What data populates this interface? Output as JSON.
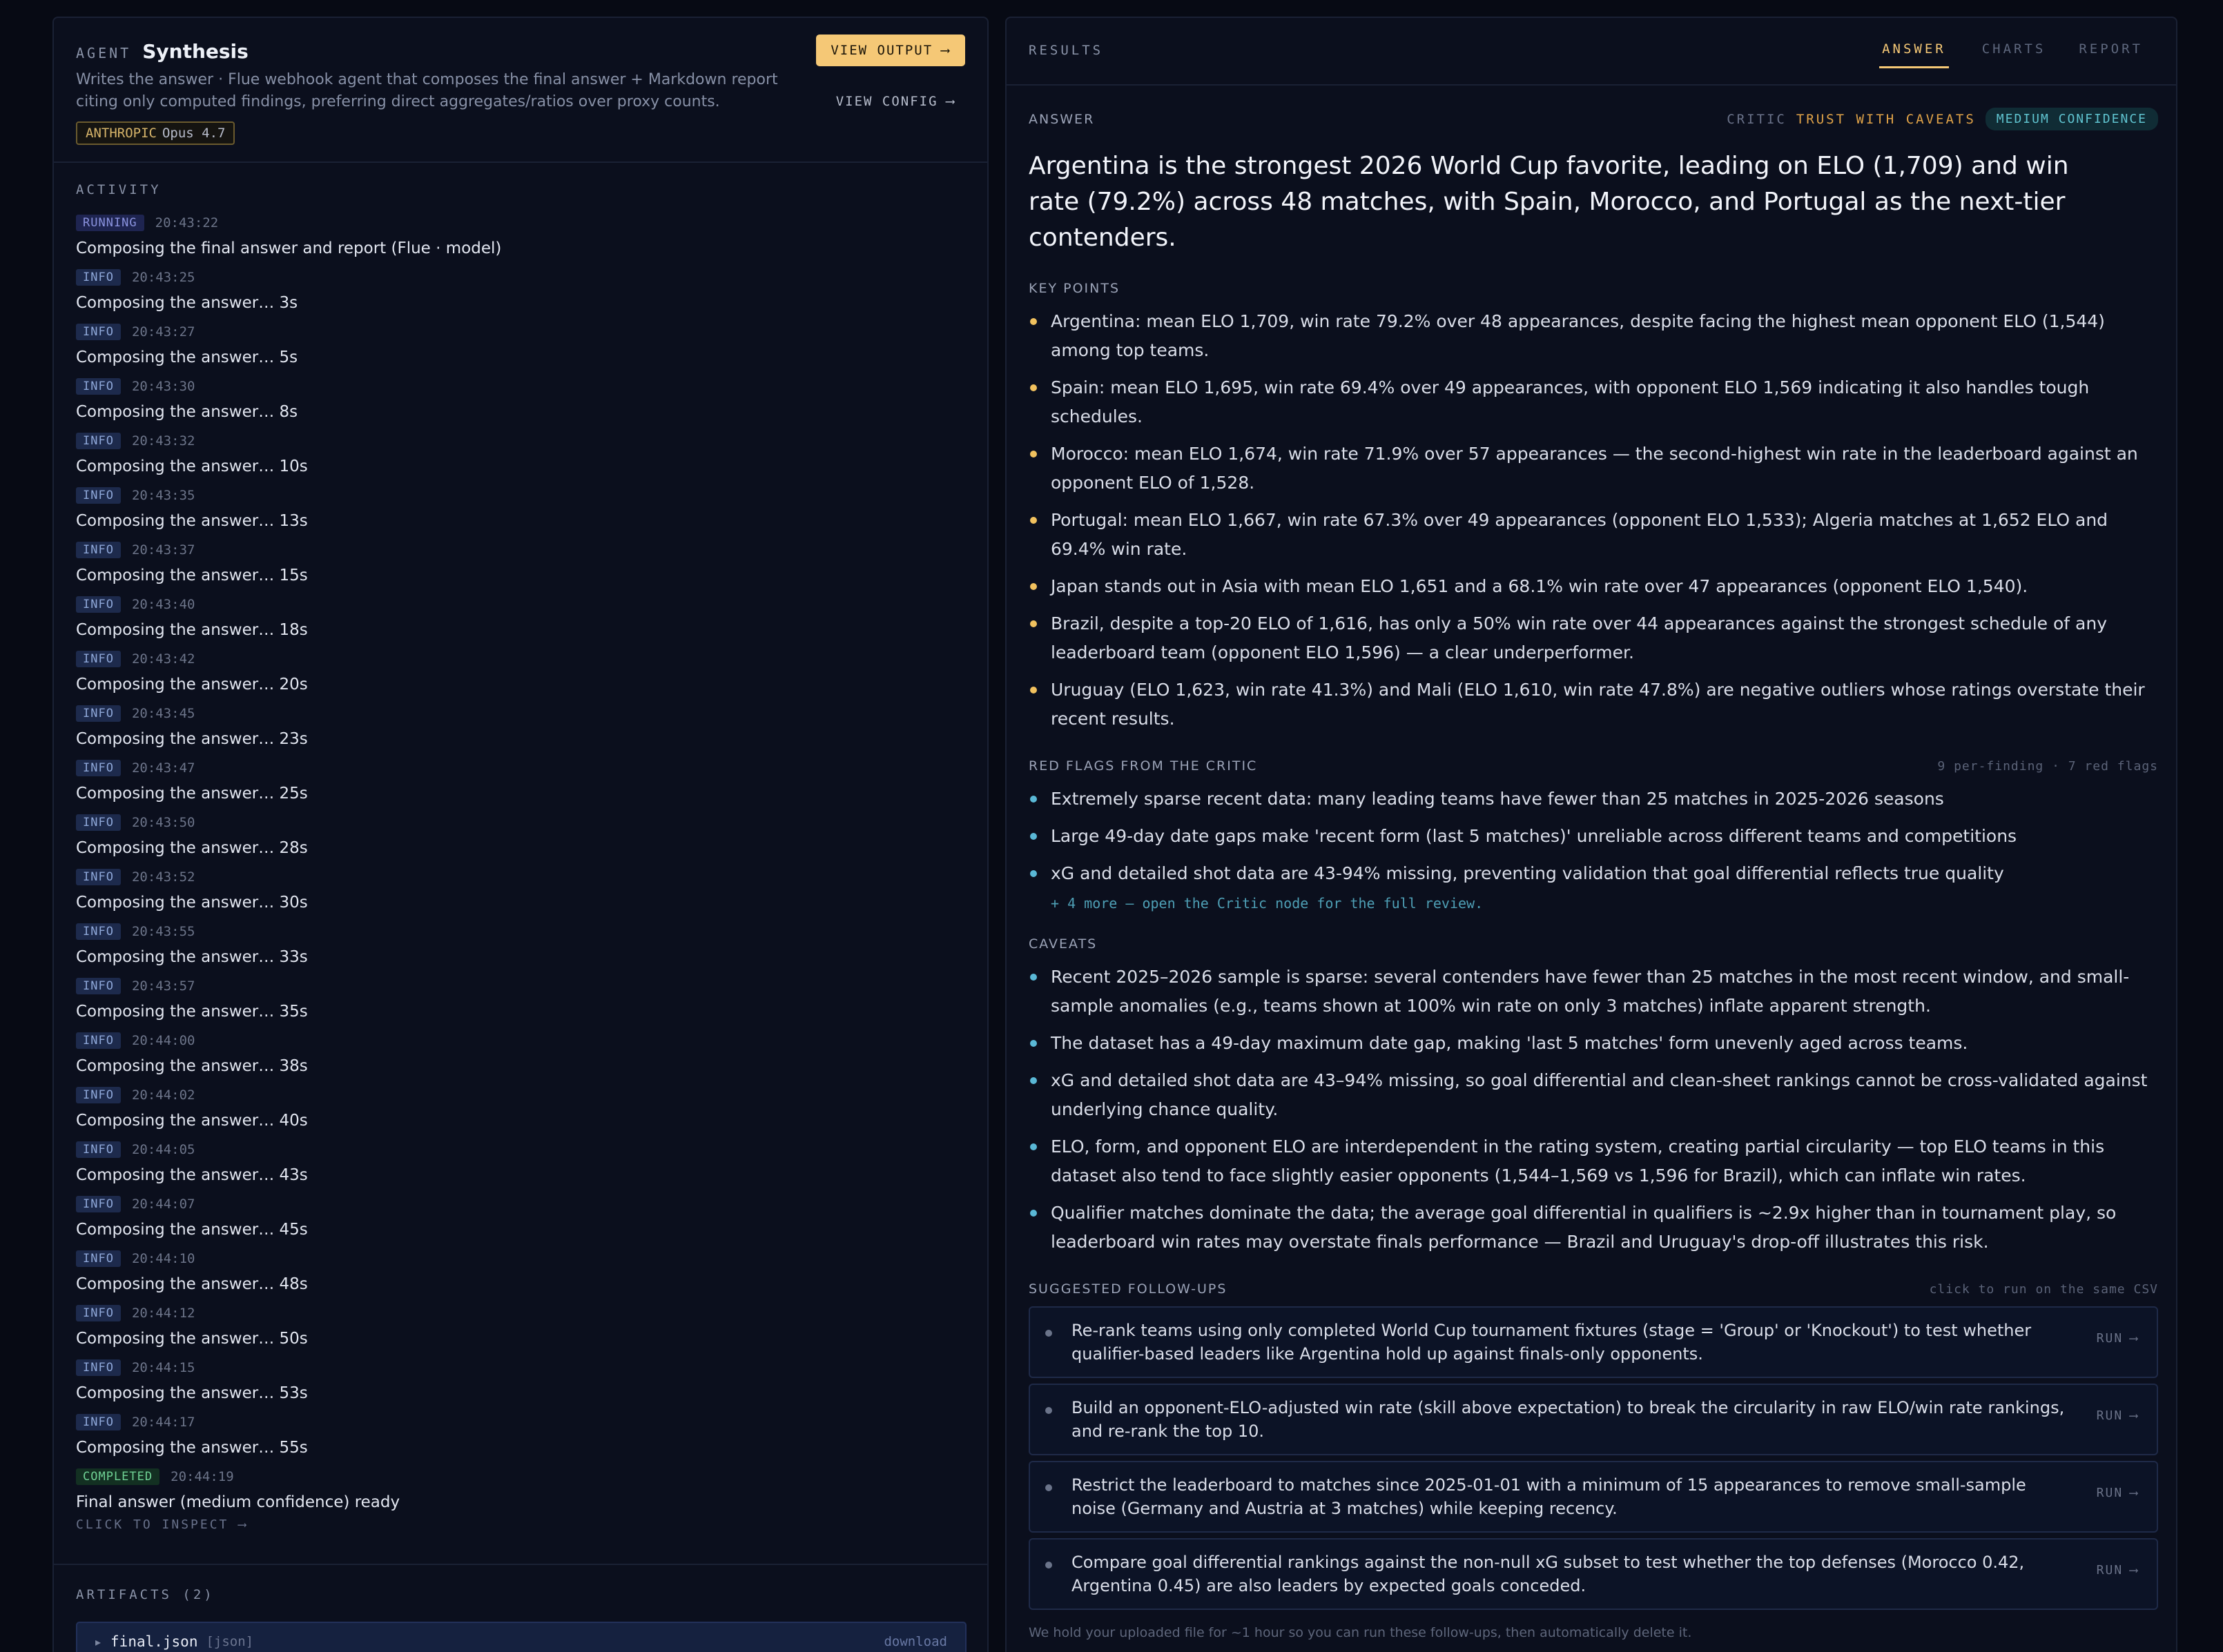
{
  "agent": {
    "label": "AGENT",
    "name": "Synthesis",
    "description": "Writes the answer · Flue webhook agent that composes the final answer + Markdown report citing only computed findings, preferring direct aggregates/ratios over proxy counts.",
    "provider": "ANTHROPIC",
    "model": "Opus 4.7",
    "view_output_label": "VIEW OUTPUT",
    "view_config_label": "VIEW CONFIG"
  },
  "activity": {
    "title": "ACTIVITY",
    "entries": [
      {
        "status": "RUNNING",
        "time": "20:43:22",
        "text": "Composing the final answer and report (Flue · model)"
      },
      {
        "status": "INFO",
        "time": "20:43:25",
        "text": "Composing the answer… 3s"
      },
      {
        "status": "INFO",
        "time": "20:43:27",
        "text": "Composing the answer… 5s"
      },
      {
        "status": "INFO",
        "time": "20:43:30",
        "text": "Composing the answer… 8s"
      },
      {
        "status": "INFO",
        "time": "20:43:32",
        "text": "Composing the answer… 10s"
      },
      {
        "status": "INFO",
        "time": "20:43:35",
        "text": "Composing the answer… 13s"
      },
      {
        "status": "INFO",
        "time": "20:43:37",
        "text": "Composing the answer… 15s"
      },
      {
        "status": "INFO",
        "time": "20:43:40",
        "text": "Composing the answer… 18s"
      },
      {
        "status": "INFO",
        "time": "20:43:42",
        "text": "Composing the answer… 20s"
      },
      {
        "status": "INFO",
        "time": "20:43:45",
        "text": "Composing the answer… 23s"
      },
      {
        "status": "INFO",
        "time": "20:43:47",
        "text": "Composing the answer… 25s"
      },
      {
        "status": "INFO",
        "time": "20:43:50",
        "text": "Composing the answer… 28s"
      },
      {
        "status": "INFO",
        "time": "20:43:52",
        "text": "Composing the answer… 30s"
      },
      {
        "status": "INFO",
        "time": "20:43:55",
        "text": "Composing the answer… 33s"
      },
      {
        "status": "INFO",
        "time": "20:43:57",
        "text": "Composing the answer… 35s"
      },
      {
        "status": "INFO",
        "time": "20:44:00",
        "text": "Composing the answer… 38s"
      },
      {
        "status": "INFO",
        "time": "20:44:02",
        "text": "Composing the answer… 40s"
      },
      {
        "status": "INFO",
        "time": "20:44:05",
        "text": "Composing the answer… 43s"
      },
      {
        "status": "INFO",
        "time": "20:44:07",
        "text": "Composing the answer… 45s"
      },
      {
        "status": "INFO",
        "time": "20:44:10",
        "text": "Composing the answer… 48s"
      },
      {
        "status": "INFO",
        "time": "20:44:12",
        "text": "Composing the answer… 50s"
      },
      {
        "status": "INFO",
        "time": "20:44:15",
        "text": "Composing the answer… 53s"
      },
      {
        "status": "INFO",
        "time": "20:44:17",
        "text": "Composing the answer… 55s"
      },
      {
        "status": "COMPLETED",
        "time": "20:44:19",
        "text": "Final answer (medium confidence) ready"
      }
    ],
    "inspect_label": "CLICK TO INSPECT"
  },
  "artifacts": {
    "title": "ARTIFACTS (2)",
    "items": [
      {
        "name": "final.json",
        "type": "[json]",
        "action": "download"
      }
    ]
  },
  "results": {
    "title": "RESULTS",
    "tabs": [
      {
        "label": "ANSWER",
        "active": true
      },
      {
        "label": "CHARTS",
        "active": false
      },
      {
        "label": "REPORT",
        "active": false
      }
    ],
    "answer_label": "ANSWER",
    "critic_label": "CRITIC",
    "critic_verdict": "TRUST WITH CAVEATS",
    "confidence": "MEDIUM CONFIDENCE",
    "headline": "Argentina is the strongest 2026 World Cup favorite, leading on ELO (1,709) and win rate (79.2%) across 48 matches, with Spain, Morocco, and Portugal as the next-tier contenders.",
    "key_points_label": "KEY POINTS",
    "key_points": [
      "Argentina: mean ELO 1,709, win rate 79.2% over 48 appearances, despite facing the highest mean opponent ELO (1,544) among top teams.",
      "Spain: mean ELO 1,695, win rate 69.4% over 49 appearances, with opponent ELO 1,569 indicating it also handles tough schedules.",
      "Morocco: mean ELO 1,674, win rate 71.9% over 57 appearances — the second-highest win rate in the leaderboard against an opponent ELO of 1,528.",
      "Portugal: mean ELO 1,667, win rate 67.3% over 49 appearances (opponent ELO 1,533); Algeria matches at 1,652 ELO and 69.4% win rate.",
      "Japan stands out in Asia with mean ELO 1,651 and a 68.1% win rate over 47 appearances (opponent ELO 1,540).",
      "Brazil, despite a top-20 ELO of 1,616, has only a 50% win rate over 44 appearances against the strongest schedule of any leaderboard team (opponent ELO 1,596) — a clear underperformer.",
      "Uruguay (ELO 1,623, win rate 41.3%) and Mali (ELO 1,610, win rate 47.8%) are negative outliers whose ratings overstate their recent results."
    ],
    "red_flags_label": "RED FLAGS FROM THE CRITIC",
    "red_flags_note": "9 per-finding · 7 red flags",
    "red_flags": [
      "Extremely sparse recent data: many leading teams have fewer than 25 matches in 2025-2026 seasons",
      "Large 49-day date gaps make 'recent form (last 5 matches)' unreliable across different teams and competitions",
      "xG and detailed shot data are 43-94% missing, preventing validation that goal differential reflects true quality"
    ],
    "red_flags_more": "+ 4 more — open the Critic node for the full review.",
    "caveats_label": "CAVEATS",
    "caveats": [
      "Recent 2025–2026 sample is sparse: several contenders have fewer than 25 matches in the most recent window, and small-sample anomalies (e.g., teams shown at 100% win rate on only 3 matches) inflate apparent strength.",
      "The dataset has a 49-day maximum date gap, making 'last 5 matches' form unevenly aged across teams.",
      "xG and detailed shot data are 43–94% missing, so goal differential and clean-sheet rankings cannot be cross-validated against underlying chance quality.",
      "ELO, form, and opponent ELO are interdependent in the rating system, creating partial circularity — top ELO teams in this dataset also tend to face slightly easier opponents (1,544–1,569 vs 1,596 for Brazil), which can inflate win rates.",
      "Qualifier matches dominate the data; the average goal differential in qualifiers is ~2.9x higher than in tournament play, so leaderboard win rates may overstate finals performance — Brazil and Uruguay's drop-off illustrates this risk."
    ],
    "followups_label": "SUGGESTED FOLLOW-UPS",
    "followups_note": "click to run on the same CSV",
    "run_label": "RUN",
    "followups": [
      "Re-rank teams using only completed World Cup tournament fixtures (stage = 'Group' or 'Knockout') to test whether qualifier-based leaders like Argentina hold up against finals-only opponents.",
      "Build an opponent-ELO-adjusted win rate (skill above expectation) to break the circularity in raw ELO/win rate rankings, and re-rank the top 10.",
      "Restrict the leaderboard to matches since 2025-01-01 with a minimum of 15 appearances to remove small-sample noise (Germany and Austria at 3 matches) while keeping recency.",
      "Compare goal differential rankings against the non-null xG subset to test whether the top defenses (Morocco 0.42, Argentina 0.45) are also leaders by expected goals conceded."
    ],
    "footnote": "We hold your uploaded file for ~1 hour so you can run these follow-ups, then automatically delete it."
  },
  "colors": {
    "accent": "#f5c876",
    "background": "#070a14",
    "panel": "#0b0f1d",
    "critic_verdict": "#e0a348",
    "confidence": "#5fc3cf",
    "completed": "#6fd194"
  }
}
